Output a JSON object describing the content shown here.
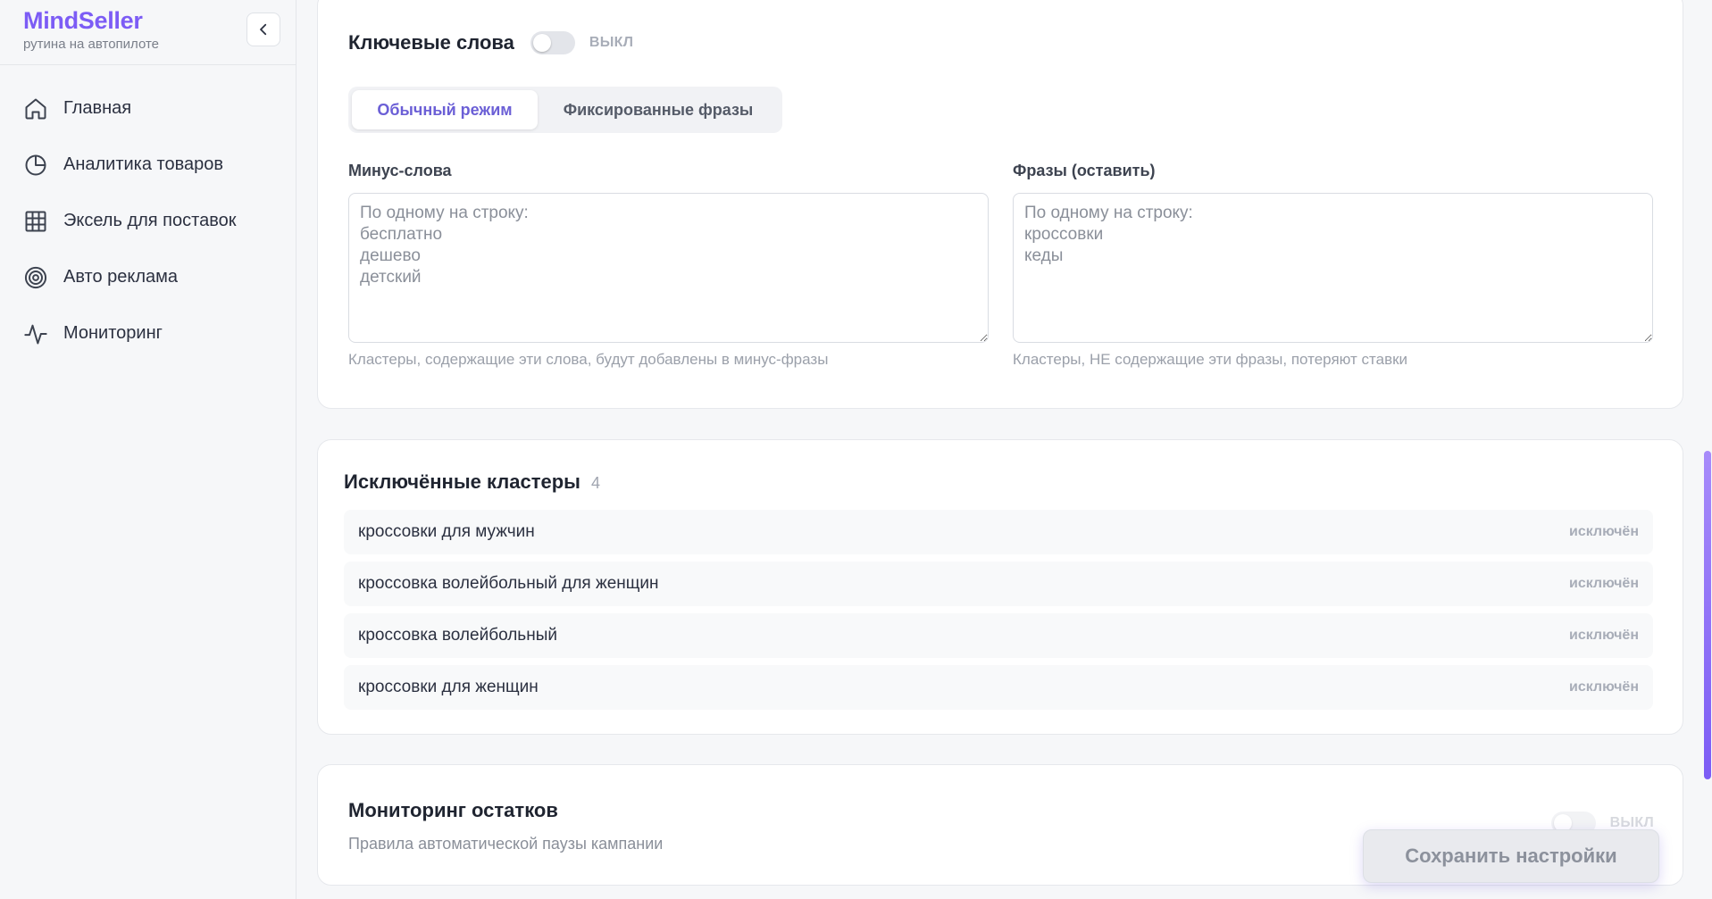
{
  "brand": {
    "name": "MindSeller",
    "tagline": "рутина на автопилоте"
  },
  "sidebar": {
    "items": [
      {
        "label": "Главная",
        "icon": "home-icon"
      },
      {
        "label": "Аналитика товаров",
        "icon": "pie-chart-icon"
      },
      {
        "label": "Эксель для поставок",
        "icon": "grid-icon"
      },
      {
        "label": "Авто реклама",
        "icon": "target-icon"
      },
      {
        "label": "Мониторинг",
        "icon": "activity-icon"
      }
    ]
  },
  "keywords": {
    "title": "Ключевые слова",
    "toggle_state": "ВЫКЛ",
    "tabs": [
      "Обычный режим",
      "Фиксированные фразы"
    ],
    "active_tab": "Обычный режим",
    "minus": {
      "label": "Минус-слова",
      "placeholder": "По одному на строку:\nбесплатно\nдешево\nдетский",
      "hint": "Кластеры, содержащие эти слова, будут добавлены в минус-фразы"
    },
    "phrases": {
      "label": "Фразы (оставить)",
      "placeholder": "По одному на строку:\nкроссовки\nкеды",
      "hint": "Кластеры, НЕ содержащие эти фразы, потеряют ставки"
    }
  },
  "excluded": {
    "title": "Исключённые кластеры",
    "count": "4",
    "rows": [
      {
        "text": "кроссовки для мужчин",
        "status": "исключён"
      },
      {
        "text": "кроссовка волейбольный для женщин",
        "status": "исключён"
      },
      {
        "text": "кроссовка волейбольный",
        "status": "исключён"
      },
      {
        "text": "кроссовки для женщин",
        "status": "исключён"
      }
    ]
  },
  "monitoring": {
    "title": "Мониторинг остатков",
    "subtitle": "Правила автоматической паузы кампании",
    "toggle_state": "ВЫКЛ"
  },
  "save_label": "Сохранить настройки",
  "colors": {
    "accent": "#7c5cf5",
    "tab_active": "#6b5fd6"
  }
}
